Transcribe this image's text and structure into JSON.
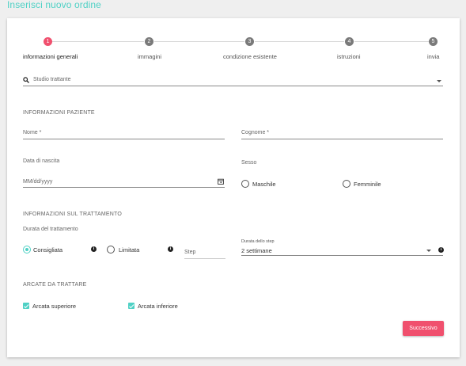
{
  "page": {
    "title": "Inserisci nuovo ordine"
  },
  "stepper": {
    "steps": [
      {
        "number": "1",
        "label": "informazioni generali"
      },
      {
        "number": "2",
        "label": "immagini"
      },
      {
        "number": "3",
        "label": "condizione esistente"
      },
      {
        "number": "4",
        "label": "istruzioni"
      },
      {
        "number": "5",
        "label": "invia"
      }
    ],
    "active_step": 1
  },
  "search": {
    "placeholder": "Studio trattante"
  },
  "patient": {
    "section_title": "INFORMAZIONI PAZIENTE",
    "name_label": "Nome *",
    "surname_label": "Cognome *",
    "birthdate_label": "Data di nascita",
    "birthdate_placeholder": "MM/dd/yyyy",
    "sex_label": "Sesso",
    "sex_options": [
      "Maschile",
      "Femminile"
    ]
  },
  "treatment": {
    "section_title": "INFORMAZIONI SUL TRATTAMENTO",
    "duration_label": "Durata del trattamento",
    "options": [
      "Consigliata",
      "Limitata"
    ],
    "selected_option": "Consigliata",
    "step_placeholder": "Step",
    "step_duration_label": "Durata dello step",
    "step_duration_value": "2 settimane"
  },
  "arches": {
    "section_title": "ARCATE DA TRATTARE",
    "options": [
      "Arcata superiore",
      "Arcata inferiore"
    ],
    "checked": [
      true,
      true
    ]
  },
  "actions": {
    "next_label": "Successivo"
  },
  "colors": {
    "accent": "#4fd1c5",
    "primary_button": "#f0506e",
    "inactive_step": "#7a7a7a"
  }
}
